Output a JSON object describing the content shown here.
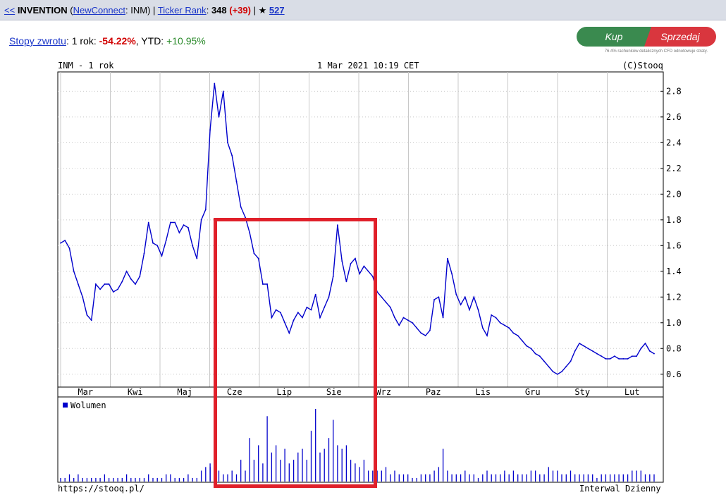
{
  "topbar": {
    "back": "<<",
    "name": "INVENTION",
    "paren_open": "(",
    "market": "NewConnect",
    "ticker_part": ": INM)",
    "sep1": "|",
    "rank_label": "Ticker Rank",
    "rank_colon": ":",
    "rank_value": "348",
    "rank_change": "(+39)",
    "sep2": "|",
    "star": "★",
    "star_count": "527"
  },
  "returns": {
    "label": "Stopy zwrotu",
    "one_year_label": ": 1 rok: ",
    "one_year_value": "-54.22%",
    "ytd_label": ", YTD: ",
    "ytd_value": "+10.95%"
  },
  "trade": {
    "buy_label": "Kup",
    "sell_label": "Sprzedaj",
    "disclaimer": "76.4% rachunków detalicznych CFD odnotowuje straty."
  },
  "chart_header": {
    "left": "INM - 1 rok",
    "center": "1 Mar 2021 10:19 CET",
    "right": "(C)Stooq"
  },
  "chart_footer": {
    "left": "https://stooq.pl/",
    "right": "Interwal Dzienny"
  },
  "colors": {
    "series": "#0000cc",
    "grid": "#c8c8c8",
    "highlight": "#e0202a"
  },
  "chart_data": {
    "type": "line",
    "title": "",
    "ylim": [
      0.5,
      2.95
    ],
    "yticks": [
      "2.8",
      "2.6",
      "2.4",
      "2.2",
      "2.0",
      "1.8",
      "1.6",
      "1.4",
      "1.2",
      "1.0",
      "0.8",
      "0.6"
    ],
    "ytick_values": [
      2.8,
      2.6,
      2.4,
      2.2,
      2.0,
      1.8,
      1.6,
      1.4,
      1.2,
      1.0,
      0.8,
      0.6
    ],
    "months": [
      "Mar",
      "Kwi",
      "Maj",
      "Cze",
      "Lip",
      "Sie",
      "Wrz",
      "Paz",
      "Lis",
      "Gru",
      "Sty",
      "Lut"
    ],
    "volume_legend": "Wolumen",
    "series": [
      {
        "name": "INM",
        "close": [
          1.62,
          1.64,
          1.58,
          1.4,
          1.3,
          1.2,
          1.06,
          1.02,
          1.3,
          1.26,
          1.3,
          1.3,
          1.24,
          1.26,
          1.32,
          1.4,
          1.34,
          1.3,
          1.36,
          1.54,
          1.78,
          1.62,
          1.6,
          1.52,
          1.64,
          1.78,
          1.78,
          1.7,
          1.76,
          1.74,
          1.6,
          1.5,
          1.8,
          1.88,
          2.5,
          2.86,
          2.6,
          2.8,
          2.4,
          2.3,
          2.1,
          1.9,
          1.82,
          1.7,
          1.54,
          1.5,
          1.3,
          1.3,
          1.04,
          1.1,
          1.08,
          1.0,
          0.92,
          1.02,
          1.08,
          1.04,
          1.12,
          1.1,
          1.22,
          1.04,
          1.12,
          1.2,
          1.36,
          1.76,
          1.48,
          1.32,
          1.46,
          1.5,
          1.38,
          1.44,
          1.4,
          1.36,
          1.24,
          1.2,
          1.16,
          1.12,
          1.04,
          0.98,
          1.04,
          1.02,
          1.0,
          0.96,
          0.92,
          0.9,
          0.94,
          1.18,
          1.2,
          1.04,
          1.5,
          1.38,
          1.22,
          1.14,
          1.2,
          1.1,
          1.2,
          1.1,
          0.96,
          0.9,
          1.06,
          1.04,
          1.0,
          0.98,
          0.96,
          0.92,
          0.9,
          0.86,
          0.82,
          0.8,
          0.76,
          0.74,
          0.7,
          0.66,
          0.62,
          0.6,
          0.62,
          0.66,
          0.7,
          0.78,
          0.84,
          0.82,
          0.8,
          0.78,
          0.76,
          0.74,
          0.72,
          0.72,
          0.74,
          0.72,
          0.72,
          0.72,
          0.74,
          0.74,
          0.8,
          0.84,
          0.78,
          0.76
        ]
      },
      {
        "name": "Wolumen",
        "volume": [
          1,
          1,
          2,
          1,
          2,
          1,
          1,
          1,
          1,
          1,
          2,
          1,
          1,
          1,
          1,
          2,
          1,
          1,
          1,
          1,
          2,
          1,
          1,
          1,
          2,
          2,
          1,
          1,
          1,
          2,
          1,
          1,
          3,
          4,
          5,
          4,
          3,
          3,
          2,
          2,
          3,
          2,
          6,
          3,
          12,
          6,
          10,
          5,
          18,
          8,
          10,
          6,
          9,
          5,
          6,
          8,
          9,
          6,
          14,
          20,
          8,
          9,
          12,
          17,
          10,
          9,
          10,
          6,
          5,
          4,
          6,
          3,
          3,
          3,
          3,
          4,
          2,
          3,
          2,
          2,
          2,
          1,
          1,
          2,
          2,
          2,
          3,
          4,
          9,
          3,
          2,
          2,
          2,
          3,
          2,
          2,
          1,
          2,
          3,
          2,
          2,
          2,
          2,
          3,
          2,
          3,
          2,
          2,
          2,
          3,
          3,
          2,
          2,
          4,
          3,
          3,
          2,
          2,
          3,
          2,
          2,
          2,
          2,
          2,
          1,
          2,
          2,
          2,
          2,
          2,
          2,
          2,
          3,
          3,
          3,
          2,
          2,
          2
        ]
      }
    ]
  }
}
